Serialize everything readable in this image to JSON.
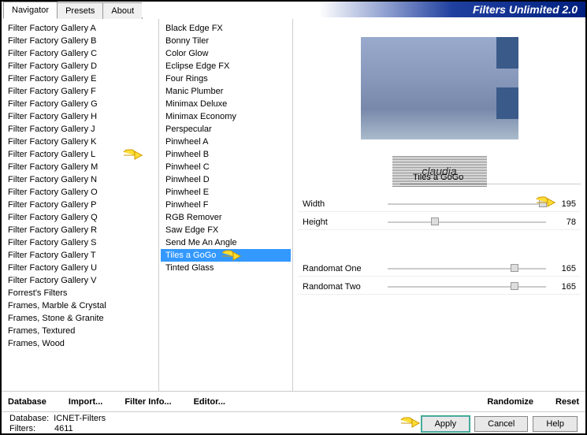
{
  "app_title": "Filters Unlimited 2.0",
  "tabs": [
    "Navigator",
    "Presets",
    "About"
  ],
  "active_tab": 0,
  "categories": [
    "Filter Factory Gallery A",
    "Filter Factory Gallery B",
    "Filter Factory Gallery C",
    "Filter Factory Gallery D",
    "Filter Factory Gallery E",
    "Filter Factory Gallery F",
    "Filter Factory Gallery G",
    "Filter Factory Gallery H",
    "Filter Factory Gallery J",
    "Filter Factory Gallery K",
    "Filter Factory Gallery L",
    "Filter Factory Gallery M",
    "Filter Factory Gallery N",
    "Filter Factory Gallery O",
    "Filter Factory Gallery P",
    "Filter Factory Gallery Q",
    "Filter Factory Gallery R",
    "Filter Factory Gallery S",
    "Filter Factory Gallery T",
    "Filter Factory Gallery U",
    "Filter Factory Gallery V",
    "Forrest's Filters",
    "Frames, Marble & Crystal",
    "Frames, Stone & Granite",
    "Frames, Textured",
    "Frames, Wood"
  ],
  "pointed_category_index": 10,
  "filters": [
    "Black Edge FX",
    "Bonny Tiler",
    "Color Glow",
    "Eclipse Edge FX",
    "Four Rings",
    "Manic Plumber",
    "Minimax Deluxe",
    "Minimax Economy",
    "Perspecular",
    "Pinwheel A",
    "Pinwheel B",
    "Pinwheel C",
    "Pinwheel D",
    "Pinwheel E",
    "Pinwheel F",
    "RGB Remover",
    "Saw Edge FX",
    "Send Me An Angle",
    "Tiles a GoGo",
    "Tinted Glass"
  ],
  "selected_filter_index": 18,
  "watermark_text": "claudia",
  "current_filter": "Tiles a GoGo",
  "params": [
    {
      "label": "Width",
      "value": 195,
      "pos": 98
    },
    {
      "label": "Height",
      "value": 78,
      "pos": 30
    }
  ],
  "random_params": [
    {
      "label": "Randomat One",
      "value": 165,
      "pos": 80
    },
    {
      "label": "Randomat Two",
      "value": 165,
      "pos": 80
    }
  ],
  "toolbar": {
    "database": "Database",
    "import": "Import...",
    "filter_info": "Filter Info...",
    "editor": "Editor...",
    "randomize": "Randomize",
    "reset": "Reset"
  },
  "footer": {
    "db_label": "Database:",
    "db_value": "ICNET-Filters",
    "filters_label": "Filters:",
    "filters_value": "4611",
    "apply": "Apply",
    "cancel": "Cancel",
    "help": "Help"
  }
}
